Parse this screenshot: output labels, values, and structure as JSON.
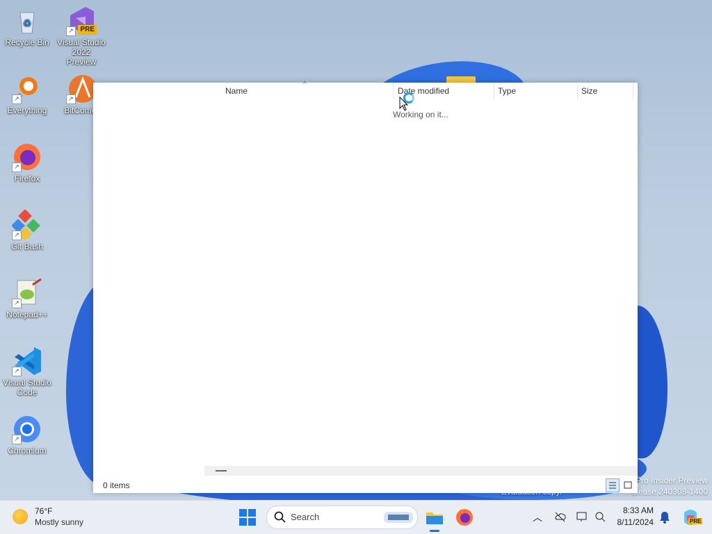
{
  "desktop": {
    "icons": [
      {
        "label": "Recycle Bin"
      },
      {
        "label": "Visual Studio 2022 Preview",
        "badge": "PRE"
      },
      {
        "label": "Everything"
      },
      {
        "label": "BitComet"
      },
      {
        "label": "Firefox"
      },
      {
        "label": "Git Bash"
      },
      {
        "label": "Notepad++"
      },
      {
        "label": "Visual Studio Code"
      },
      {
        "label": "Chromium"
      }
    ],
    "watermark": {
      "line1": "Pro Insider Preview",
      "line2": "Evaluation copy.",
      "line3": "elease.240308-1400"
    }
  },
  "explorer": {
    "columns": {
      "name": "Name",
      "date_modified": "Date modified",
      "type": "Type",
      "size": "Size"
    },
    "working_text": "Working on it...",
    "status": "0 items"
  },
  "taskbar": {
    "weather": {
      "temp": "76°F",
      "desc": "Mostly sunny"
    },
    "search_placeholder": "Search",
    "clock": {
      "time": "8:33 AM",
      "date": "8/11/2024"
    },
    "copilot_badge": "PRE"
  }
}
